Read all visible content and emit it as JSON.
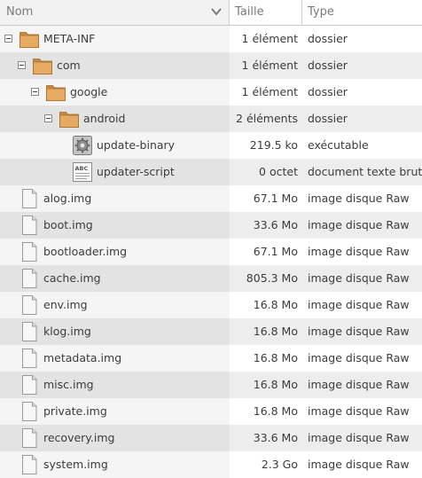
{
  "header": {
    "name_label": "Nom",
    "size_label": "Taille",
    "type_label": "Type"
  },
  "rows": [
    {
      "name": "META-INF",
      "size": "1 élément",
      "type": "dossier",
      "icon": "folder-icon",
      "level": 0,
      "expander": true
    },
    {
      "name": "com",
      "size": "1 élément",
      "type": "dossier",
      "icon": "folder-icon",
      "level": 1,
      "expander": true
    },
    {
      "name": "google",
      "size": "1 élément",
      "type": "dossier",
      "icon": "folder-icon",
      "level": 2,
      "expander": true
    },
    {
      "name": "android",
      "size": "2 éléments",
      "type": "dossier",
      "icon": "folder-icon",
      "level": 3,
      "expander": true
    },
    {
      "name": "update-binary",
      "size": "219.5 ko",
      "type": "exécutable",
      "icon": "executable-icon",
      "level": 4,
      "expander": false
    },
    {
      "name": "updater-script",
      "size": "0 octet",
      "type": "document texte brut",
      "icon": "text-document-icon",
      "level": 4,
      "expander": false
    },
    {
      "name": "alog.img",
      "size": "67.1 Mo",
      "type": "image disque Raw",
      "icon": "file-icon",
      "level": 0,
      "expander": false
    },
    {
      "name": "boot.img",
      "size": "33.6 Mo",
      "type": "image disque Raw",
      "icon": "file-icon",
      "level": 0,
      "expander": false
    },
    {
      "name": "bootloader.img",
      "size": "67.1 Mo",
      "type": "image disque Raw",
      "icon": "file-icon",
      "level": 0,
      "expander": false
    },
    {
      "name": "cache.img",
      "size": "805.3 Mo",
      "type": "image disque Raw",
      "icon": "file-icon",
      "level": 0,
      "expander": false
    },
    {
      "name": "env.img",
      "size": "16.8 Mo",
      "type": "image disque Raw",
      "icon": "file-icon",
      "level": 0,
      "expander": false
    },
    {
      "name": "klog.img",
      "size": "16.8 Mo",
      "type": "image disque Raw",
      "icon": "file-icon",
      "level": 0,
      "expander": false
    },
    {
      "name": "metadata.img",
      "size": "16.8 Mo",
      "type": "image disque Raw",
      "icon": "file-icon",
      "level": 0,
      "expander": false
    },
    {
      "name": "misc.img",
      "size": "16.8 Mo",
      "type": "image disque Raw",
      "icon": "file-icon",
      "level": 0,
      "expander": false
    },
    {
      "name": "private.img",
      "size": "16.8 Mo",
      "type": "image disque Raw",
      "icon": "file-icon",
      "level": 0,
      "expander": false
    },
    {
      "name": "recovery.img",
      "size": "33.6 Mo",
      "type": "image disque Raw",
      "icon": "file-icon",
      "level": 0,
      "expander": false
    },
    {
      "name": "system.img",
      "size": "2.3 Go",
      "type": "image disque Raw",
      "icon": "file-icon",
      "level": 0,
      "expander": false
    }
  ],
  "colors": {
    "folder": "#e0a35a",
    "row_alt": "#ededed",
    "header_text": "#7a7a7a"
  }
}
